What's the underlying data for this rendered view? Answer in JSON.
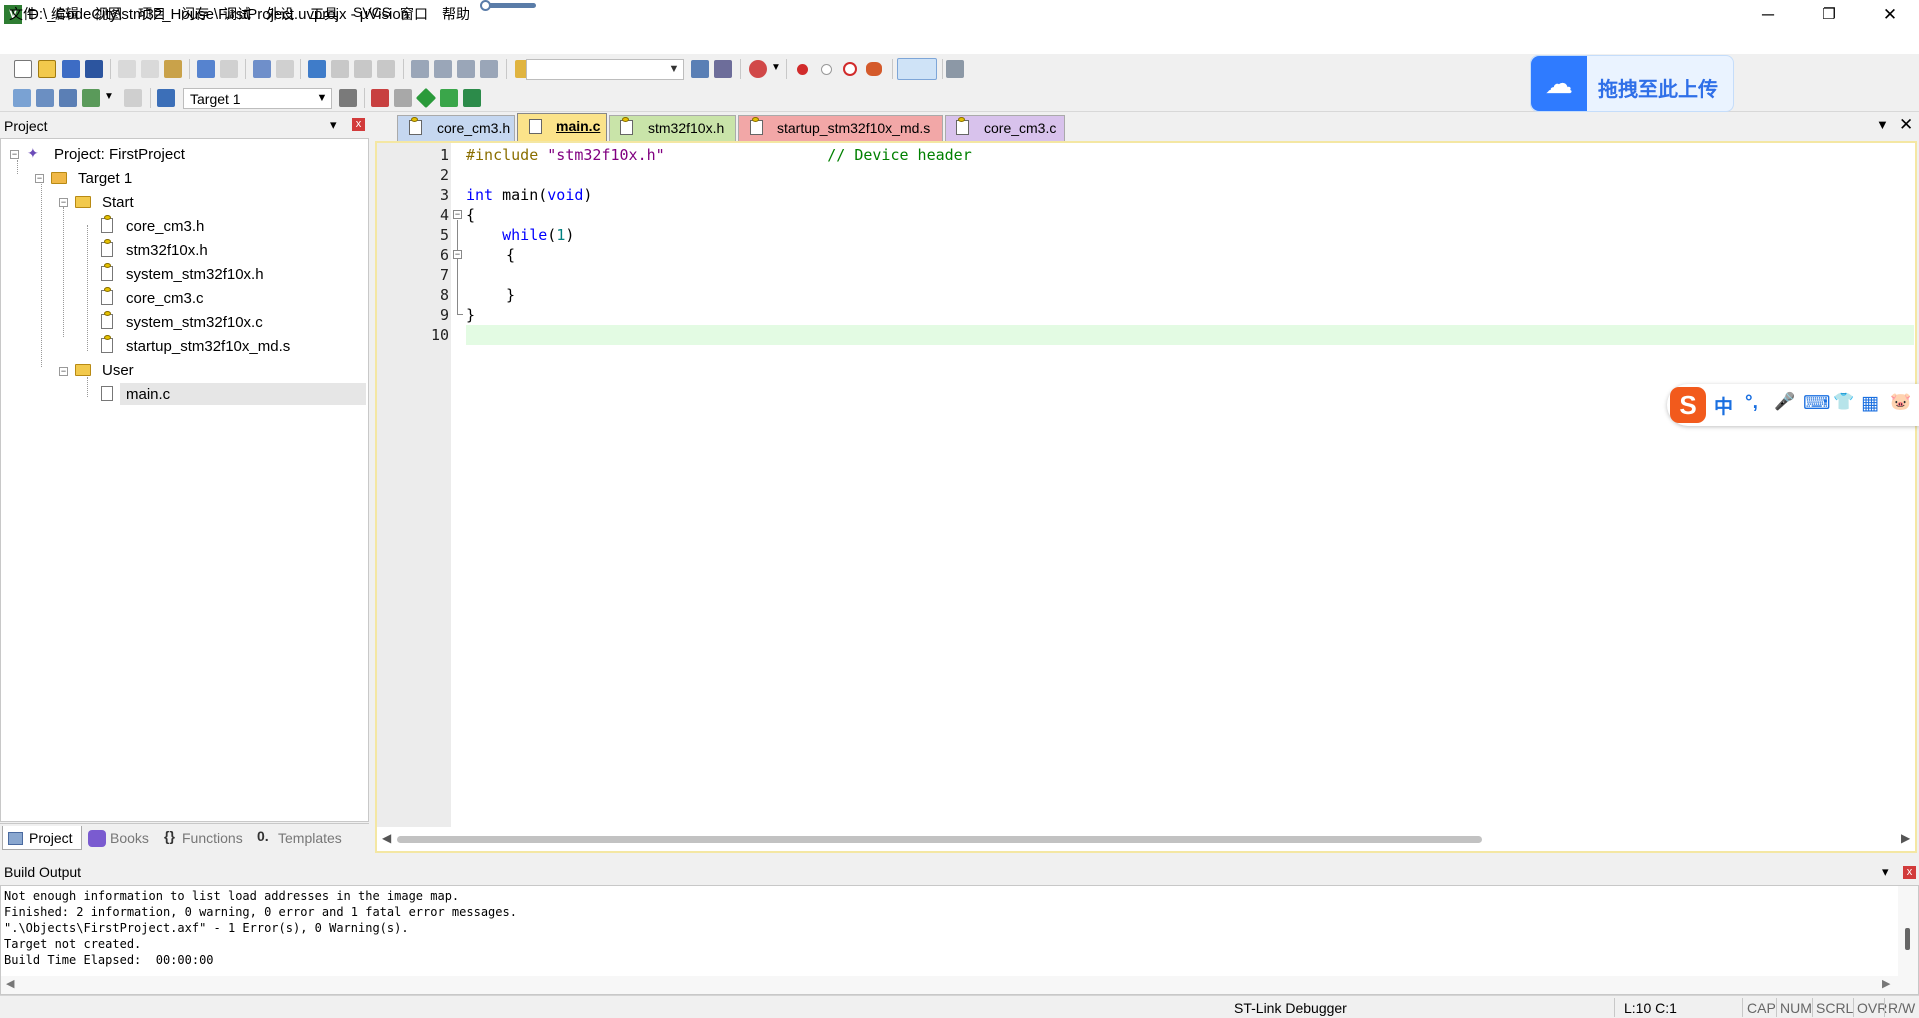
{
  "window": {
    "title": "D:\\_CodeCity\\stm32_House\\FirstProject.uvprojx - µVision",
    "app_icon": "uvision-icon",
    "minimize": "─",
    "restore": "❐",
    "close": "✕"
  },
  "menu": [
    "文件",
    "编辑",
    "视图",
    "项目",
    "闪存",
    "调试",
    "外设",
    "工具",
    "SVCS",
    "窗口",
    "帮助"
  ],
  "toolbar": {
    "target_select": "Target 1",
    "find_text": ""
  },
  "baidu_drop": {
    "label": "拖拽至此上传"
  },
  "project_panel": {
    "title": "Project",
    "pin": "📌",
    "close": "x",
    "tree": {
      "root": "Project: FirstProject",
      "target": "Target 1",
      "groups": [
        {
          "name": "Start",
          "files": [
            "core_cm3.h",
            "stm32f10x.h",
            "system_stm32f10x.h",
            "core_cm3.c",
            "system_stm32f10x.c",
            "startup_stm32f10x_md.s"
          ]
        },
        {
          "name": "User",
          "files": [
            "main.c"
          ]
        }
      ]
    },
    "tabs": [
      "Project",
      "Books",
      "Functions",
      "Templates"
    ]
  },
  "editor": {
    "tabs": [
      {
        "label": "core_cm3.h",
        "color": "#c5d7f0"
      },
      {
        "label": "main.c",
        "color": "#fbe38a",
        "active": true
      },
      {
        "label": "stm32f10x.h",
        "color": "#c9e4a9"
      },
      {
        "label": "startup_stm32f10x_md.s",
        "color": "#f2a7a7"
      },
      {
        "label": "core_cm3.c",
        "color": "#d8c2ec"
      }
    ],
    "dropdown": "▼",
    "close": "✕",
    "lines": [
      {
        "n": "1",
        "code": "#include \"stm32f10x.h\"                  // Device header"
      },
      {
        "n": "2",
        "code": ""
      },
      {
        "n": "3",
        "code": "int main(void)"
      },
      {
        "n": "4",
        "code": "{"
      },
      {
        "n": "5",
        "code": "    while(1)"
      },
      {
        "n": "6",
        "code": "    {"
      },
      {
        "n": "7",
        "code": ""
      },
      {
        "n": "8",
        "code": "    }"
      },
      {
        "n": "9",
        "code": "}"
      },
      {
        "n": "10",
        "code": ""
      }
    ],
    "code_parts": {
      "l1_pp": "#include",
      "l1_str": "\"stm32f10x.h\"",
      "l1_cm": "// Device header",
      "l3_kw1": "int",
      "l3_mid": " main(",
      "l3_kw2": "void",
      "l3_end": ")",
      "l4": "{",
      "l5_kw": "while",
      "l5_open": "(",
      "l5_num": "1",
      "l5_close": ")",
      "l6": "{",
      "l8": "}",
      "l9": "}"
    }
  },
  "ime": {
    "logo": "S",
    "lang": "中",
    "punct": "°,",
    "mic": "🎤",
    "keyboard": "⌨",
    "skin": "👕",
    "apps": "▦",
    "face": "🐷"
  },
  "build_output": {
    "title": "Build Output",
    "lines": [
      "Not enough information to list load addresses in the image map.",
      "Finished: 2 information, 0 warning, 0 error and 1 fatal error messages.",
      "\".\\Objects\\FirstProject.axf\" - 1 Error(s), 0 Warning(s).",
      "Target not created.",
      "Build Time Elapsed:  00:00:00"
    ]
  },
  "status_bar": {
    "debugger": "ST-Link Debugger",
    "position": "L:10 C:1",
    "indicators": [
      "CAP",
      "NUM",
      "SCRL",
      "OVR",
      "R/W"
    ]
  }
}
